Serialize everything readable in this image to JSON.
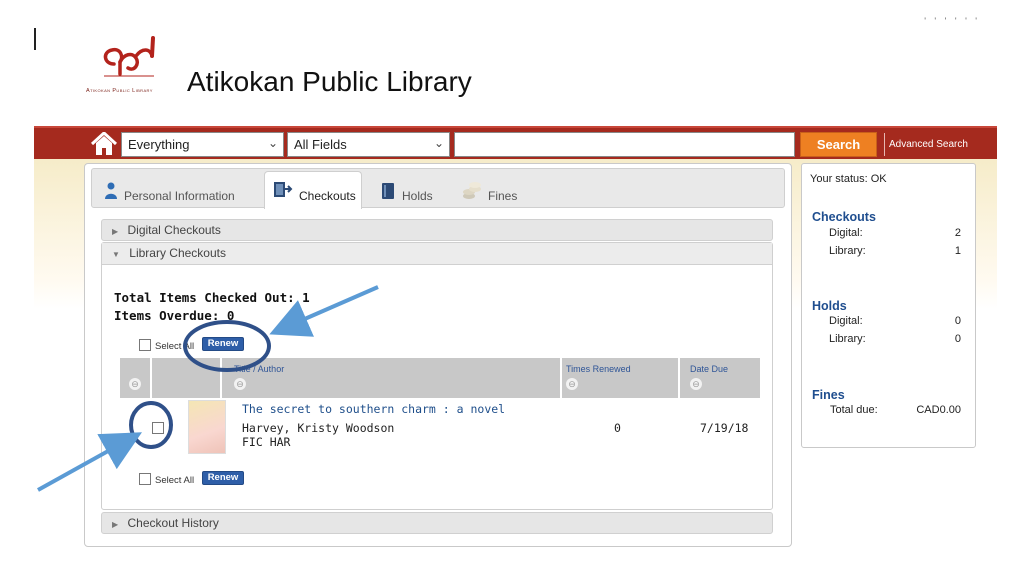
{
  "library": {
    "name": "Atikokan Public Library",
    "logo_caption": "Atikokan Public Library",
    "corner_text": "' ' ' ' ' '"
  },
  "search": {
    "scope_value": "Everything",
    "field_value": "All Fields",
    "query_value": "",
    "search_label": "Search",
    "advanced_label": "Advanced Search"
  },
  "tabs": [
    {
      "label": "Personal Information",
      "icon": "person-icon"
    },
    {
      "label": "Checkouts",
      "icon": "checkout-icon"
    },
    {
      "label": "Holds",
      "icon": "book-icon"
    },
    {
      "label": "Fines",
      "icon": "coins-icon"
    }
  ],
  "sections": {
    "digital": "Digital Checkouts",
    "library": "Library Checkouts",
    "history": "Checkout History"
  },
  "totals": {
    "checked_out": "Total Items Checked Out: 1",
    "overdue": "Items Overdue: 0"
  },
  "controls": {
    "select_all_top": "Select All",
    "select_all_bottom": "Select All",
    "renew": "Renew"
  },
  "table": {
    "headers": {
      "title_author": "Title / Author",
      "times_renewed": "Times Renewed",
      "date_due": "Date Due"
    },
    "rows": [
      {
        "title": "The secret to southern charm : a novel",
        "author": "Harvey, Kristy Woodson",
        "call_number": "FIC HAR",
        "times_renewed": "0",
        "date_due": "7/19/18"
      }
    ]
  },
  "status": {
    "status_text": "Your status: OK",
    "checkouts_heading": "Checkouts",
    "checkouts": [
      {
        "label": "Digital:",
        "value": "2"
      },
      {
        "label": "Library:",
        "value": "1"
      }
    ],
    "holds_heading": "Holds",
    "holds": [
      {
        "label": "Digital:",
        "value": "0"
      },
      {
        "label": "Library:",
        "value": "0"
      }
    ],
    "fines_heading": "Fines",
    "fines": [
      {
        "label": "Total due:",
        "value": "CAD0.00"
      }
    ]
  },
  "colors": {
    "header_red": "#a52a1e",
    "search_orange": "#ee8022",
    "link_blue": "#1f4f8b",
    "annotation_blue": "#5b9bd5",
    "annotation_circle": "#2f5089"
  }
}
